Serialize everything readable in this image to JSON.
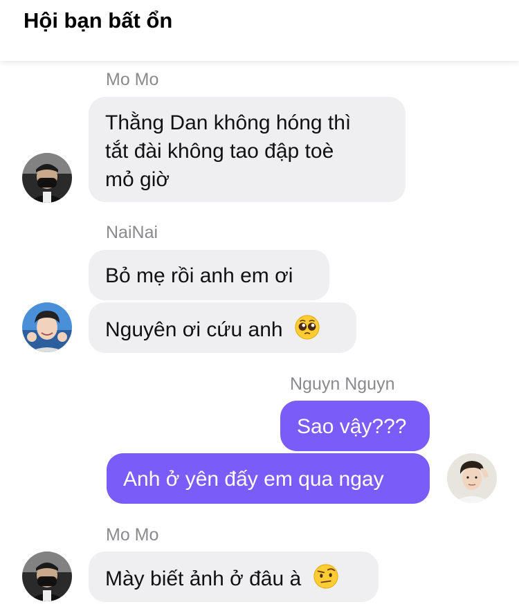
{
  "header": {
    "title": "Hội bạn bất ổn"
  },
  "messages": [
    {
      "sender": "Mo Mo",
      "lines": [
        "Thằng Dan không hóng thì",
        "tắt đài không tao đập toè",
        "mỏ giờ"
      ]
    },
    {
      "sender": "NaiNai",
      "text": "Bỏ mẹ rồi anh em ơi"
    },
    {
      "text": "Nguyên ơi cứu anh",
      "emoji": "pleading-face-icon"
    },
    {
      "sender": "Nguyn Nguyn",
      "text": "Sao vậy???"
    },
    {
      "text": "Anh ở yên đấy em qua ngay"
    },
    {
      "sender": "Mo Mo",
      "text": "Mày biết ảnh ở đâu à",
      "emoji": "raised-eyebrow-face-icon"
    }
  ],
  "colors": {
    "incoming_bubble": "#efeff1",
    "outgoing_bubble": "#7a5cf8",
    "sender_name": "#8a8a8e"
  }
}
